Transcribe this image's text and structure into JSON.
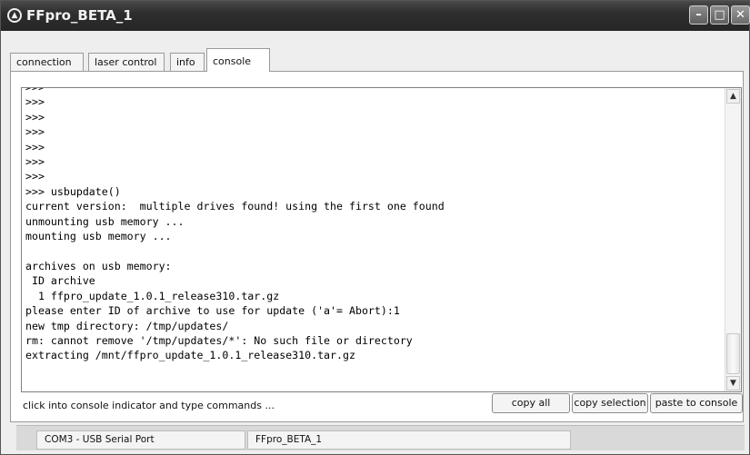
{
  "window": {
    "title": "FFpro_BETA_1",
    "controls": [
      "minimize-icon",
      "maximize-icon",
      "close-icon"
    ]
  },
  "tabs": [
    {
      "label": "connection",
      "active": false
    },
    {
      "label": "laser control",
      "active": false
    },
    {
      "label": "info",
      "active": false
    },
    {
      "label": "console",
      "active": true
    }
  ],
  "console": {
    "text": ">>>\n>>>\n>>>\n>>>\n>>>\n>>>\n>>>\n>>> usbupdate()\ncurrent version:  multiple drives found! using the first one found\nunmounting usb memory ...\nmounting usb memory ...\n\narchives on usb memory:\n ID archive\n  1 ffpro_update_1.0.1_release310.tar.gz\nplease enter ID of archive to use for update ('a'= Abort):1\nnew tmp directory: /tmp/updates/\nrm: cannot remove '/tmp/updates/*': No such file or directory\nextracting /mnt/ffpro_update_1.0.1_release310.tar.gz"
  },
  "footer": {
    "hint": "click into console indicator and type commands ...",
    "copy_all": "copy all",
    "copy_selection": "copy selection",
    "paste": "paste to console"
  },
  "statusbar": {
    "port": "COM3 - USB Serial Port",
    "device": "FFpro_BETA_1"
  },
  "colors": {
    "titlebar": "#2e2e2e",
    "panel": "#ffffff",
    "chrome": "#eeeeee"
  }
}
